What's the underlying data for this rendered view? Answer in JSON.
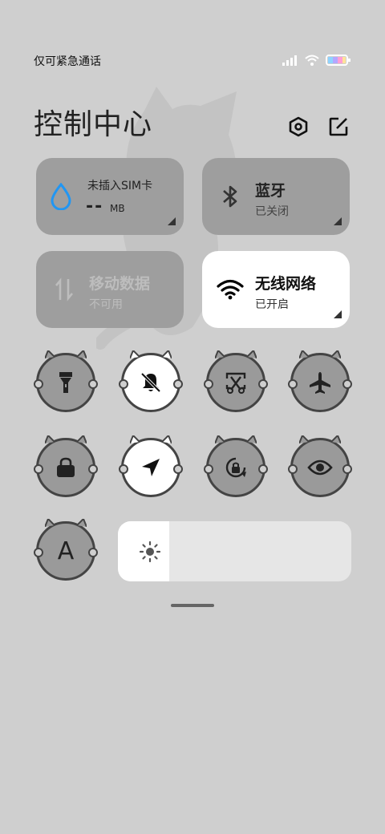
{
  "status_bar": {
    "carrier": "仅可紧急通话"
  },
  "header": {
    "title": "控制中心"
  },
  "tiles": {
    "sim": {
      "label": "未插入SIM卡",
      "value": "--",
      "unit": "MB"
    },
    "bluetooth": {
      "title": "蓝牙",
      "status": "已关闭"
    },
    "mobile_data": {
      "title": "移动数据",
      "status": "不可用"
    },
    "wifi": {
      "title": "无线网络",
      "status": "已开启"
    }
  },
  "toggles": [
    {
      "name": "flashlight",
      "icon": "flashlight-icon",
      "active": false
    },
    {
      "name": "mute",
      "icon": "bell-off-icon",
      "active": true
    },
    {
      "name": "screenshot",
      "icon": "screenshot-icon",
      "active": false
    },
    {
      "name": "airplane-mode",
      "icon": "airplane-icon",
      "active": false
    },
    {
      "name": "lock",
      "icon": "lock-icon",
      "active": false
    },
    {
      "name": "location",
      "icon": "location-icon",
      "active": true
    },
    {
      "name": "auto-rotate",
      "icon": "rotate-lock-icon",
      "active": false
    },
    {
      "name": "reading-mode",
      "icon": "eye-icon",
      "active": false
    },
    {
      "name": "auto-brightness",
      "icon": "letter-a-icon",
      "active": false
    }
  ],
  "auto_brightness_letter": "A",
  "brightness": {
    "level": 0.22,
    "icon": "sun-icon"
  },
  "colors": {
    "background": "#cfcfcf",
    "tile_inactive": "#9e9e9e",
    "tile_active": "#ffffff",
    "wifi_active": "#000000",
    "water_icon": "#2196f3"
  }
}
